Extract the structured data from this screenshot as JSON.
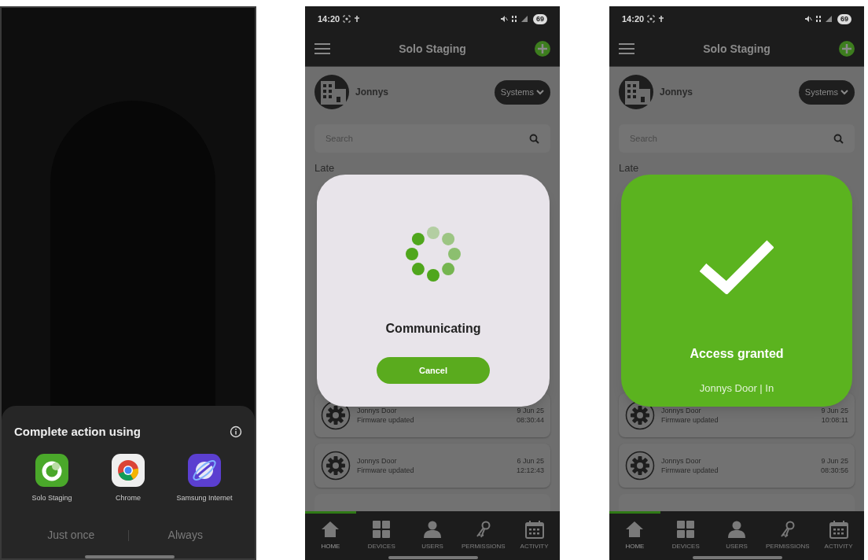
{
  "chooser_screen": {
    "sheet": {
      "title": "Complete action using",
      "apps": [
        {
          "label": "Solo Staging",
          "kind": "solo"
        },
        {
          "label": "Chrome",
          "kind": "chrome"
        },
        {
          "label": "Samsung Internet",
          "kind": "samsung"
        }
      ],
      "buttons": [
        "Just once",
        "Always"
      ]
    }
  },
  "app_screens": [
    {
      "status_bar": {
        "time": "14:20",
        "battery": "69"
      },
      "app_bar": {
        "title": "Solo Staging"
      },
      "site": {
        "name": "Jonnys",
        "dropdown": "Systems"
      },
      "search": {
        "placeholder": "Search"
      },
      "section_heading": "Late",
      "activity": [
        {
          "device": "Jonnys Door",
          "event": "Firmware updated",
          "date": "9 Jun 25",
          "time": "08:30:44"
        },
        {
          "device": "Jonnys Door",
          "event": "Firmware updated",
          "date": "6 Jun 25",
          "time": "12:12:43"
        }
      ],
      "dialog": {
        "kind": "progress",
        "title": "Communicating",
        "button": "Cancel"
      },
      "nav": [
        {
          "label": "HOME",
          "kind": "home",
          "selected": true
        },
        {
          "label": "DEVICES",
          "kind": "devices",
          "selected": false
        },
        {
          "label": "USERS",
          "kind": "users",
          "selected": false
        },
        {
          "label": "PERMISSIONS",
          "kind": "permissions",
          "selected": false
        },
        {
          "label": "ACTIVITY",
          "kind": "activity",
          "selected": false
        }
      ]
    },
    {
      "status_bar": {
        "time": "14:20",
        "battery": "69"
      },
      "app_bar": {
        "title": "Solo Staging"
      },
      "site": {
        "name": "Jonnys",
        "dropdown": "Systems"
      },
      "search": {
        "placeholder": "Search"
      },
      "section_heading": "Late",
      "activity": [
        {
          "device": "Jonnys Door",
          "event": "Firmware updated",
          "date": "9 Jun 25",
          "time": "10:08:11"
        },
        {
          "device": "Jonnys Door",
          "event": "Firmware updated",
          "date": "9 Jun 25",
          "time": "08:30:56"
        }
      ],
      "dialog": {
        "kind": "success",
        "title": "Access granted",
        "subtitle": "Jonnys Door | In"
      },
      "nav": [
        {
          "label": "HOME",
          "kind": "home",
          "selected": true
        },
        {
          "label": "DEVICES",
          "kind": "devices",
          "selected": false
        },
        {
          "label": "USERS",
          "kind": "users",
          "selected": false
        },
        {
          "label": "PERMISSIONS",
          "kind": "permissions",
          "selected": false
        },
        {
          "label": "ACTIVITY",
          "kind": "activity",
          "selected": false
        }
      ]
    }
  ]
}
